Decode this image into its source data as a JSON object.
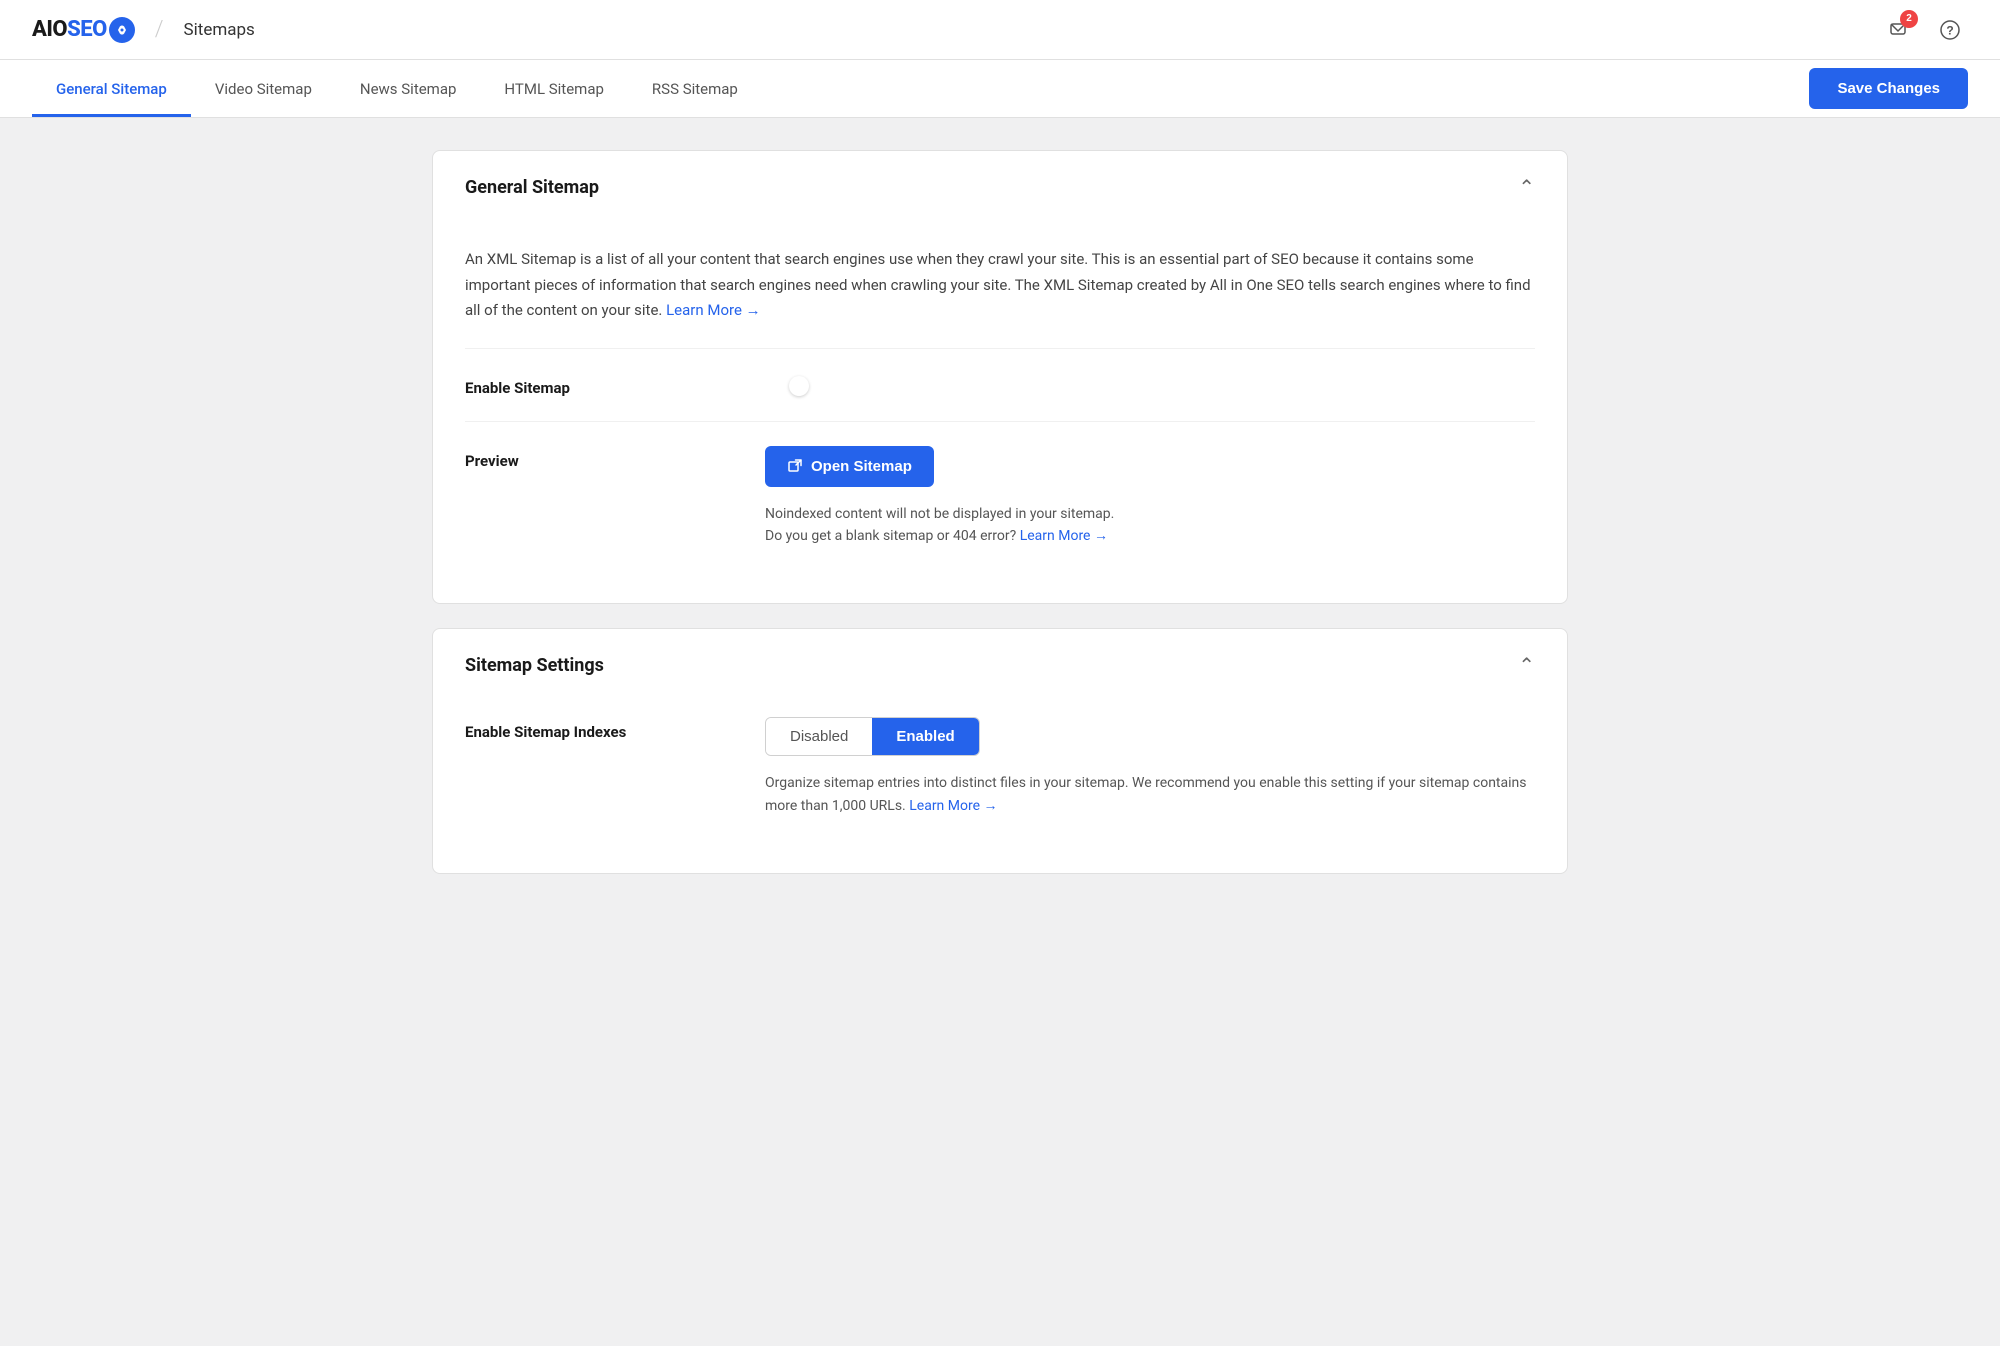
{
  "topbar": {
    "logo": {
      "aio_text": "AIO",
      "seo_text": "SEO"
    },
    "divider": "/",
    "page_title": "Sitemaps",
    "badge_count": "2"
  },
  "tabs": {
    "items": [
      {
        "id": "general",
        "label": "General Sitemap",
        "active": true
      },
      {
        "id": "video",
        "label": "Video Sitemap",
        "active": false
      },
      {
        "id": "news",
        "label": "News Sitemap",
        "active": false
      },
      {
        "id": "html",
        "label": "HTML Sitemap",
        "active": false
      },
      {
        "id": "rss",
        "label": "RSS Sitemap",
        "active": false
      }
    ],
    "save_label": "Save Changes"
  },
  "general_sitemap_card": {
    "title": "General Sitemap",
    "description": "An XML Sitemap is a list of all your content that search engines use when they crawl your site. This is an essential part of SEO because it contains some important pieces of information that search engines need when crawling your site. The XML Sitemap created by All in One SEO tells search engines where to find all of the content on your site.",
    "learn_more_label": "Learn More →",
    "enable_sitemap": {
      "label": "Enable Sitemap",
      "enabled": true
    },
    "preview": {
      "label": "Preview",
      "button_label": "Open Sitemap",
      "note_line1": "Noindexed content will not be displayed in your sitemap.",
      "note_line2": "Do you get a blank sitemap or 404 error?",
      "note_link": "Learn More →"
    }
  },
  "sitemap_settings_card": {
    "title": "Sitemap Settings",
    "enable_indexes": {
      "label": "Enable Sitemap Indexes",
      "options": [
        "Disabled",
        "Enabled"
      ],
      "selected": "Enabled",
      "description": "Organize sitemap entries into distinct files in your sitemap. We recommend you enable this setting if your sitemap contains more than 1,000 URLs.",
      "learn_more_label": "Learn More →"
    }
  }
}
